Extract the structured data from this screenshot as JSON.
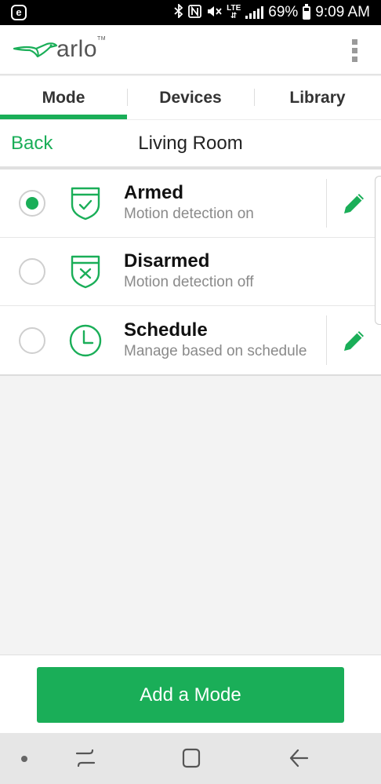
{
  "status_bar": {
    "app_badge": "e",
    "icons": [
      "bluetooth-icon",
      "nfc-icon",
      "mute-icon",
      "lte-icon",
      "signal-icon",
      "battery-icon"
    ],
    "lte_label": "LTE",
    "battery_percent": "69%",
    "time": "9:09 AM"
  },
  "header": {
    "logo_text": "arlo",
    "logo_trademark": "TM",
    "menu_icon": "kebab-menu-icon"
  },
  "tabs": [
    {
      "label": "Mode",
      "active": true
    },
    {
      "label": "Devices",
      "active": false
    },
    {
      "label": "Library",
      "active": false
    }
  ],
  "subheader": {
    "back_label": "Back",
    "title": "Living Room"
  },
  "modes": [
    {
      "title": "Armed",
      "description": "Motion detection on",
      "selected": true,
      "icon": "shield-check-icon",
      "editable": true
    },
    {
      "title": "Disarmed",
      "description": "Motion detection off",
      "selected": false,
      "icon": "shield-x-icon",
      "editable": false
    },
    {
      "title": "Schedule",
      "description": "Manage based on schedule",
      "selected": false,
      "icon": "clock-icon",
      "editable": true
    }
  ],
  "add_button_label": "Add a Mode",
  "nav_bar": {
    "icons": [
      "dot-icon",
      "recent-apps-icon",
      "home-icon",
      "back-arrow-icon"
    ]
  },
  "colors": {
    "accent": "#1aae58",
    "status_bar": "#000000",
    "background": "#f3f3f3",
    "muted_text": "#8a8a8a"
  }
}
